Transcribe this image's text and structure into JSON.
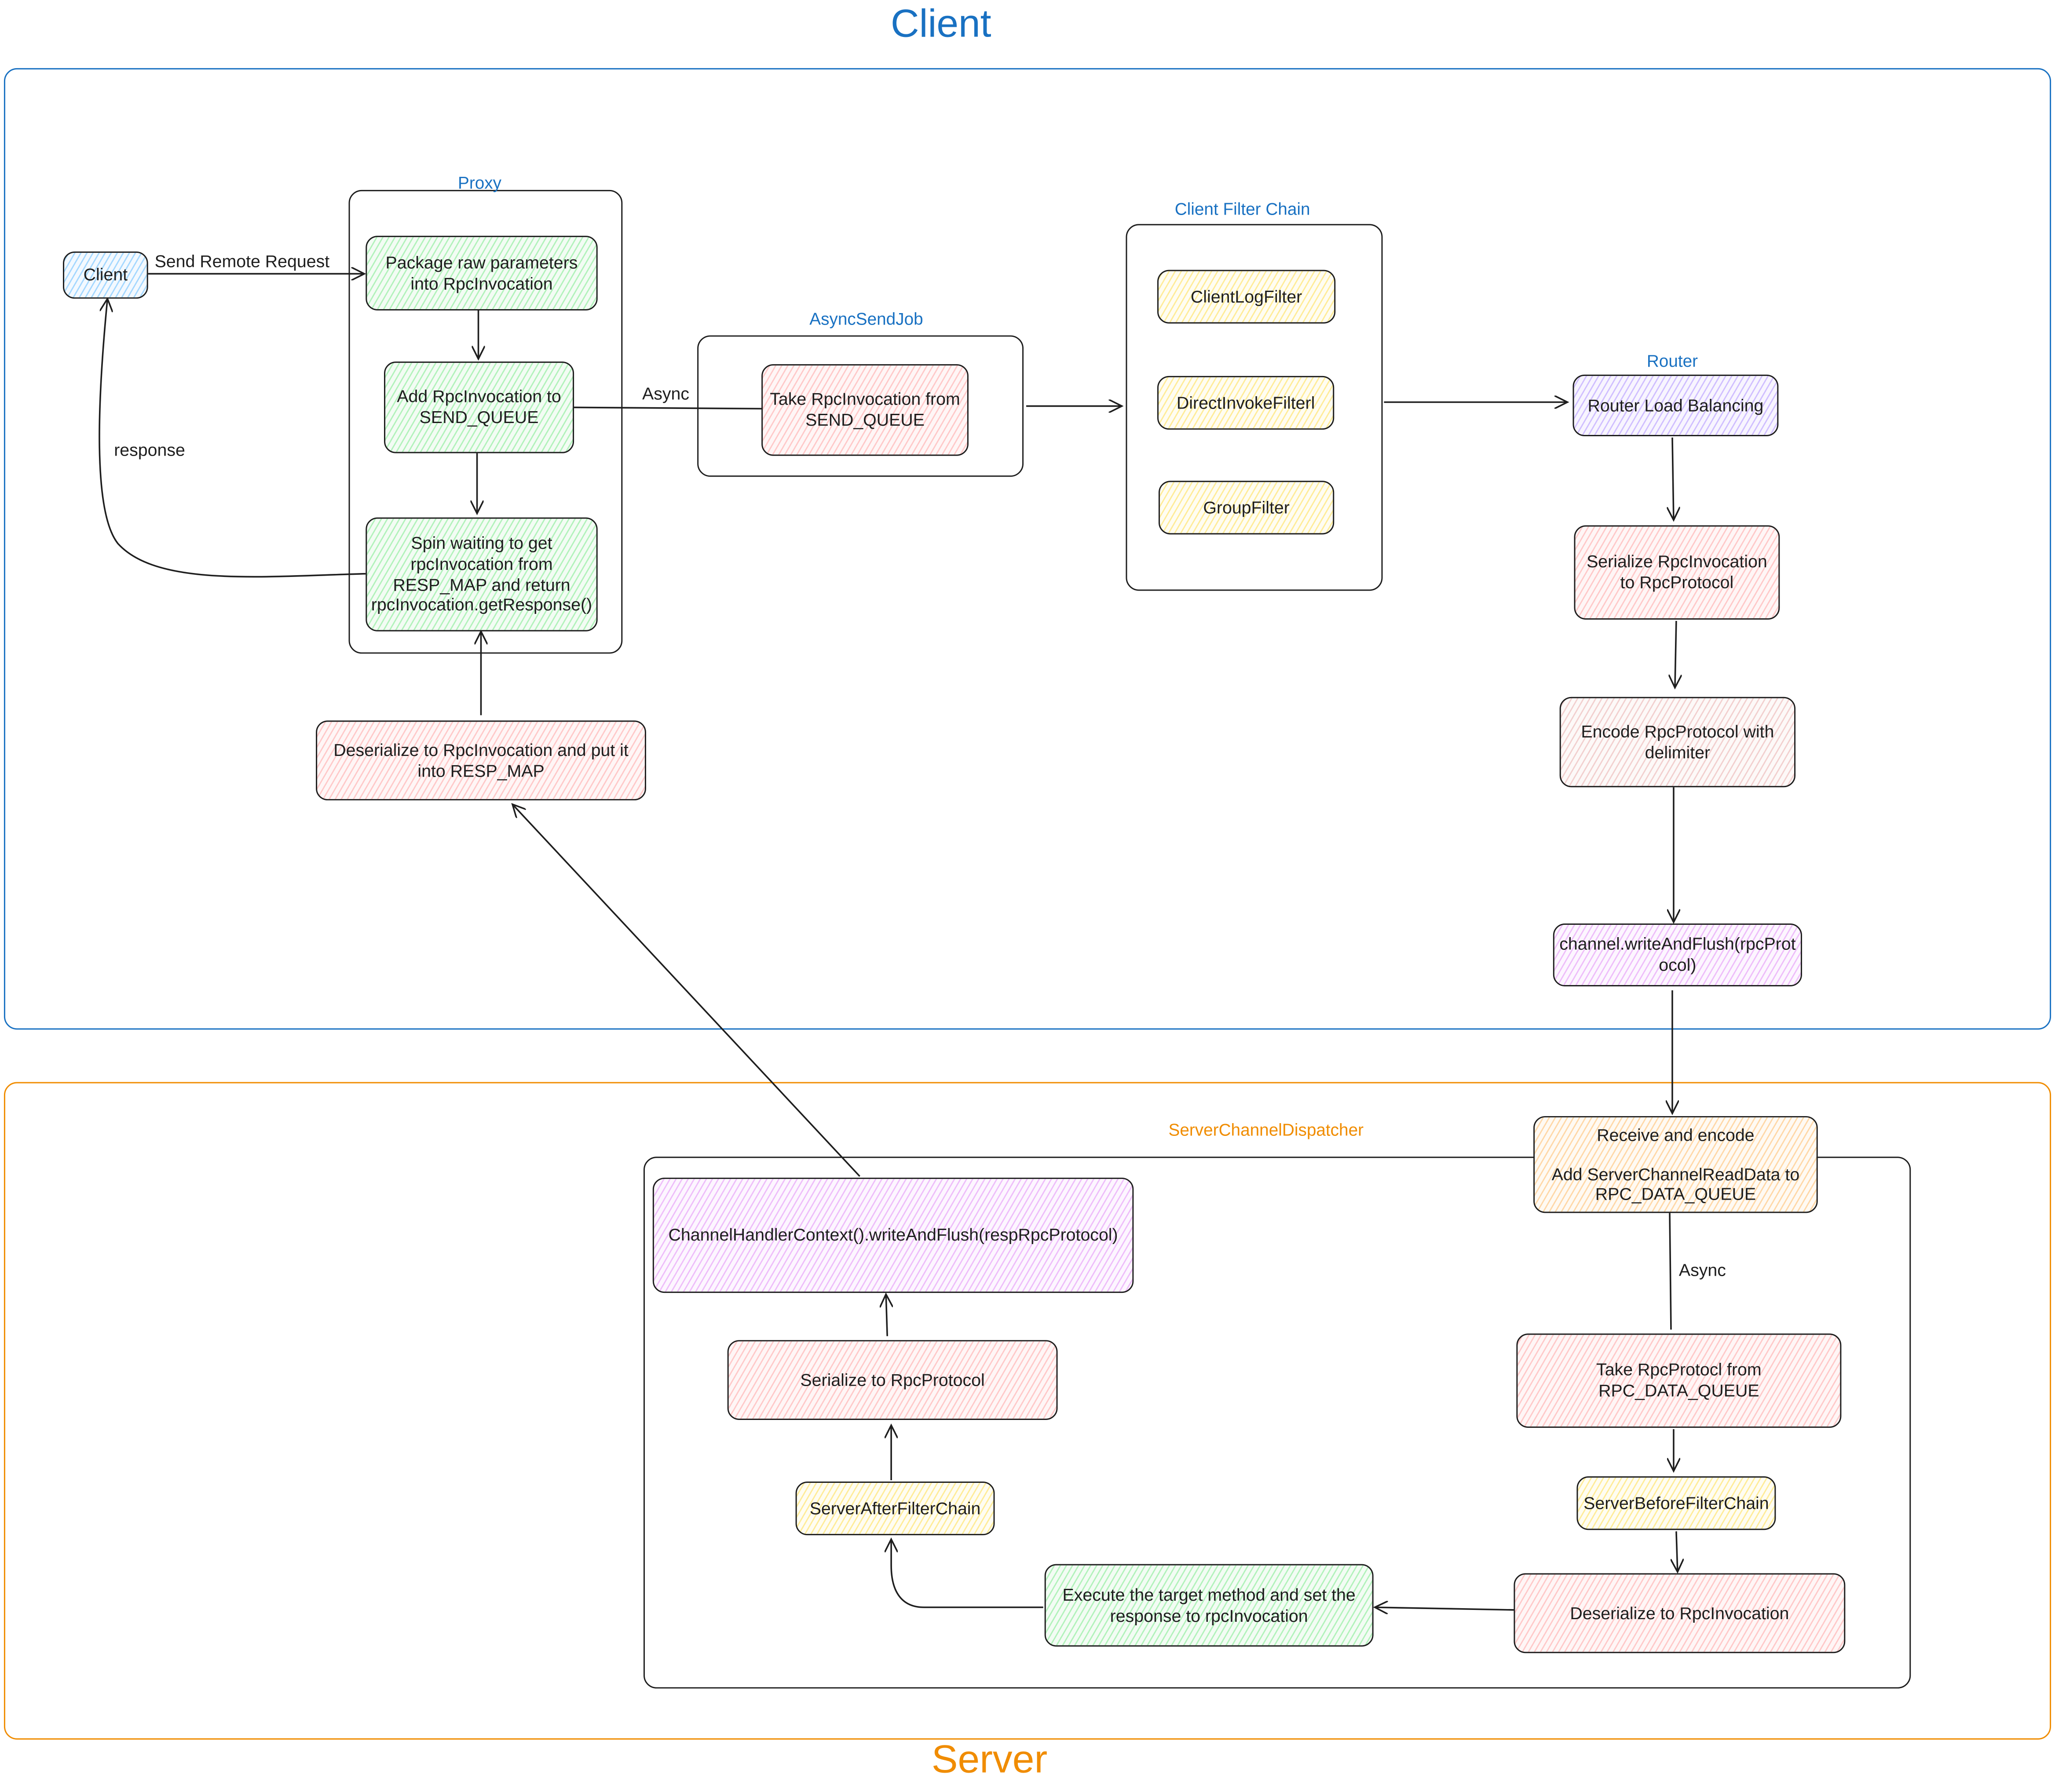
{
  "regions": {
    "client": {
      "title": "Client",
      "color": "#1971c2"
    },
    "server": {
      "title": "Server",
      "color": "#f08c00"
    }
  },
  "groups": {
    "proxy": "Proxy",
    "async_send_job": "AsyncSendJob",
    "client_filter_chain": "Client Filter Chain",
    "router": "Router",
    "server_channel_dispatcher": "ServerChannelDispatcher"
  },
  "nodes": {
    "client": "Client",
    "package_params": "Package raw parameters into RpcInvocation",
    "add_to_send_queue": "Add RpcInvocation to SEND_QUEUE",
    "spin_waiting": "Spin waiting to get rpcInvocation from RESP_MAP and return rpcInvocation.getResponse()",
    "take_from_send_queue": "Take RpcInvocation from SEND_QUEUE",
    "client_log_filter": "ClientLogFilter",
    "direct_invoke_filter": "DirectInvokeFilterl",
    "group_filter": "GroupFilter",
    "router_load_balancing": "Router Load Balancing",
    "serialize_invocation": "Serialize RpcInvocation to RpcProtocol",
    "encode_protocol": "Encode RpcProtocol with delimiter",
    "channel_write_flush": "channel.writeAndFlush(rpcProtocol)",
    "deserialize_resp_map": "Deserialize to RpcInvocation and put it into RESP_MAP",
    "receive_encode_title": "Receive and encode",
    "receive_encode_body": "Add ServerChannelReadData to RPC_DATA_QUEUE",
    "take_from_rpc_data_queue": "Take RpcProtocl from RPC_DATA_QUEUE",
    "server_before_filter_chain": "ServerBeforeFilterChain",
    "deserialize_server": "Deserialize to RpcInvocation",
    "execute_target": "Execute the target method and set the response to rpcInvocation",
    "server_after_filter_chain": "ServerAfterFilterChain",
    "serialize_server": "Serialize to RpcProtocol",
    "ctx_write_flush": "ChannelHandlerContext().writeAndFlush(respRpcProtocol)"
  },
  "edge_labels": {
    "send_remote_request": "Send Remote Request",
    "response": "response",
    "async_client": "Async",
    "async_server": "Async"
  }
}
